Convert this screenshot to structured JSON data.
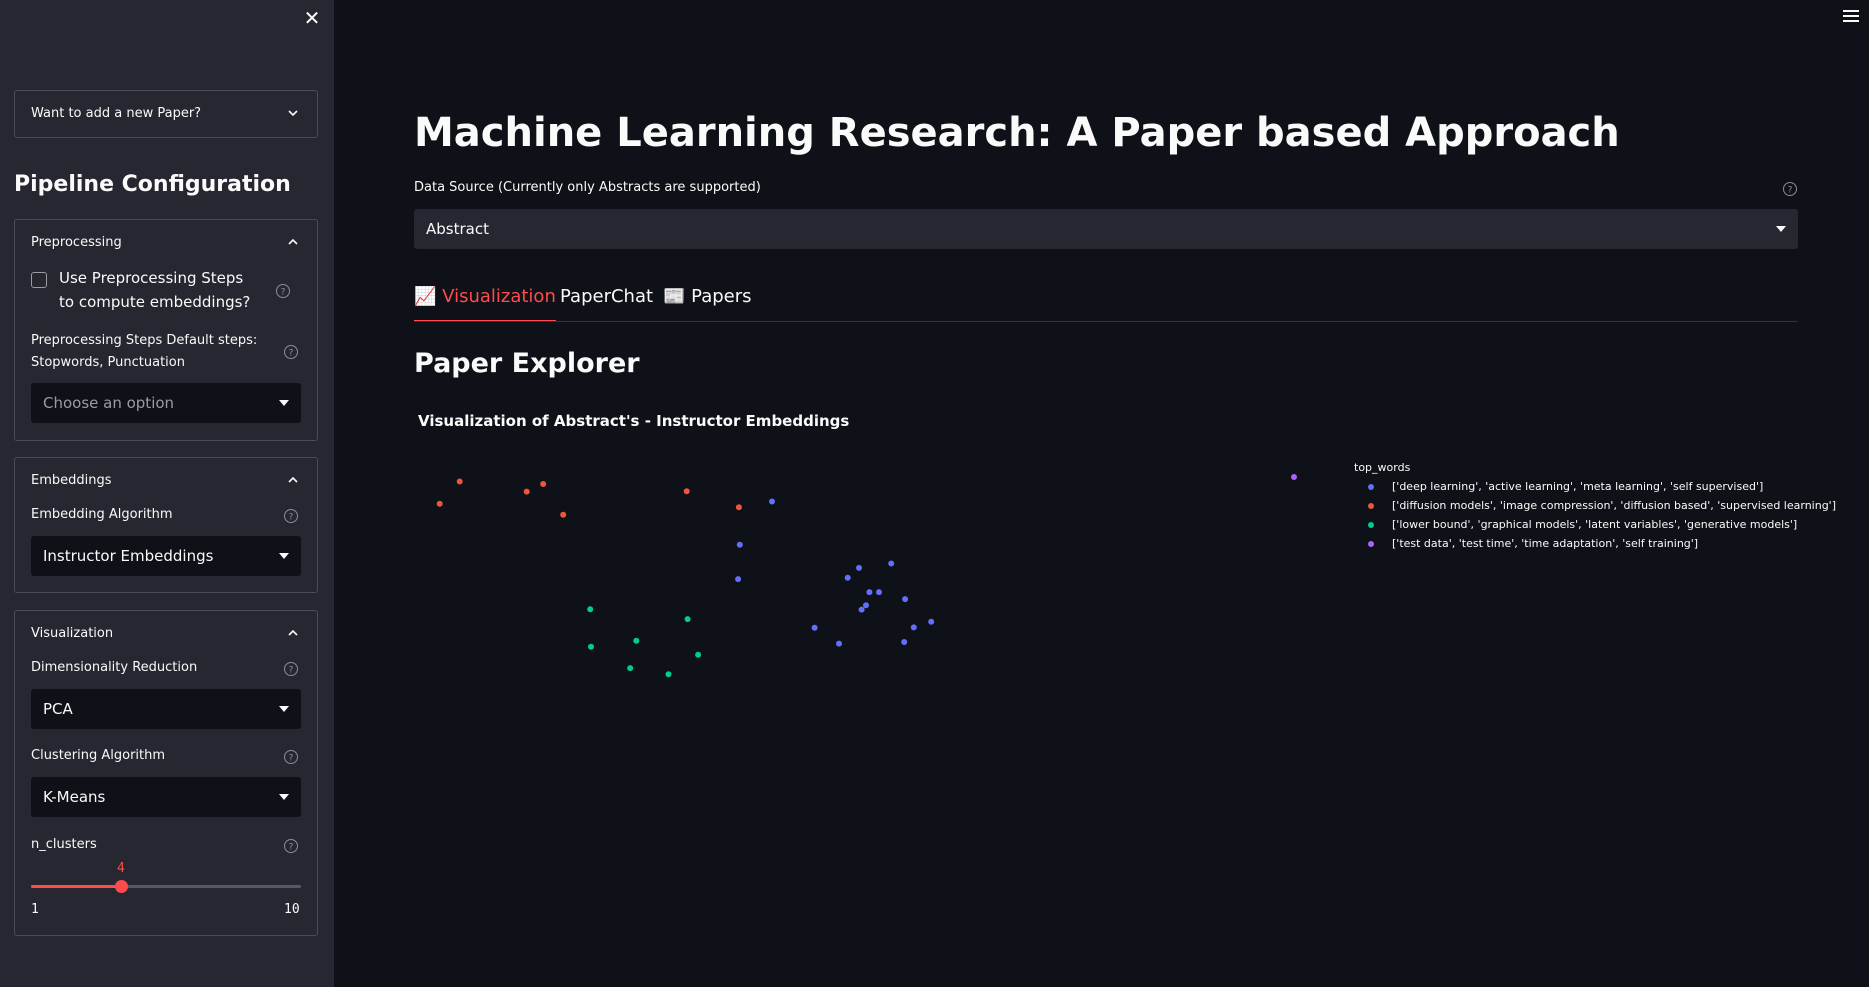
{
  "sidebar": {
    "add_paper_label": "Want to add a new Paper?",
    "title": "Pipeline Configuration",
    "preprocessing": {
      "header": "Preprocessing",
      "checkbox_label": "Use Preprocessing Steps to compute embeddings?",
      "checkbox_checked": false,
      "steps_label": "Preprocessing Steps Default steps: Stopwords, Punctuation",
      "steps_placeholder": "Choose an option"
    },
    "embeddings": {
      "header": "Embeddings",
      "algorithm_label": "Embedding Algorithm",
      "algorithm_value": "Instructor Embeddings"
    },
    "visualization": {
      "header": "Visualization",
      "dim_label": "Dimensionality Reduction",
      "dim_value": "PCA",
      "cluster_label": "Clustering Algorithm",
      "cluster_value": "K-Means",
      "n_clusters_label": "n_clusters",
      "n_clusters_value": "4",
      "n_clusters_min": "1",
      "n_clusters_max": "10"
    }
  },
  "main": {
    "title": "Machine Learning Research: A Paper based Approach",
    "data_source_label": "Data Source (Currently only Abstracts are supported)",
    "data_source_value": "Abstract",
    "tabs": [
      {
        "icon": "📈",
        "label": "Visualization"
      },
      {
        "label": "PaperChat"
      },
      {
        "icon": "📰",
        "label": "Papers"
      }
    ],
    "section_title": "Paper Explorer"
  },
  "colors": {
    "accent": "#ff4b4b",
    "cluster0": "#636efa",
    "cluster1": "#ef553b",
    "cluster2": "#00cc96",
    "cluster3": "#ab63fa"
  },
  "chart_data": {
    "type": "scatter",
    "title": "Visualization of Abstract's - Instructor Embeddings",
    "legend_title": "top_words",
    "legend_position": "top-right",
    "grid": false,
    "xlim": [
      0,
      1000
    ],
    "ylim": [
      0,
      1000
    ],
    "series": [
      {
        "name": "['deep learning', 'active learning', 'meta learning', 'self supervised']",
        "color": "#636efa",
        "x": [
          400,
          363,
          361,
          487,
          500,
          537,
          512,
          553,
          523,
          583,
          508,
          503,
          552,
          477,
          563,
          449
        ],
        "y": [
          923,
          787,
          679,
          683,
          714,
          728,
          638,
          616,
          638,
          545,
          597,
          583,
          481,
          476,
          527,
          526
        ]
      },
      {
        "name": "['diffusion models', 'image compression', 'diffusion based', 'supervised learning']",
        "color": "#ef553b",
        "x": [
          41,
          118,
          137,
          302,
          362,
          18,
          160
        ],
        "y": [
          986,
          954,
          978,
          955,
          905,
          916,
          881
        ]
      },
      {
        "name": "['lower bound', 'graphical models', 'latent variables', 'generative models']",
        "color": "#00cc96",
        "x": [
          191,
          192,
          303,
          315,
          237,
          281,
          244
        ],
        "y": [
          584,
          466,
          553,
          441,
          399,
          380,
          485
        ]
      },
      {
        "name": "['test data', 'test time', 'time adaptation', 'self training']",
        "color": "#ab63fa",
        "x": [
          1000
        ],
        "y": [
          1000
        ]
      }
    ]
  }
}
